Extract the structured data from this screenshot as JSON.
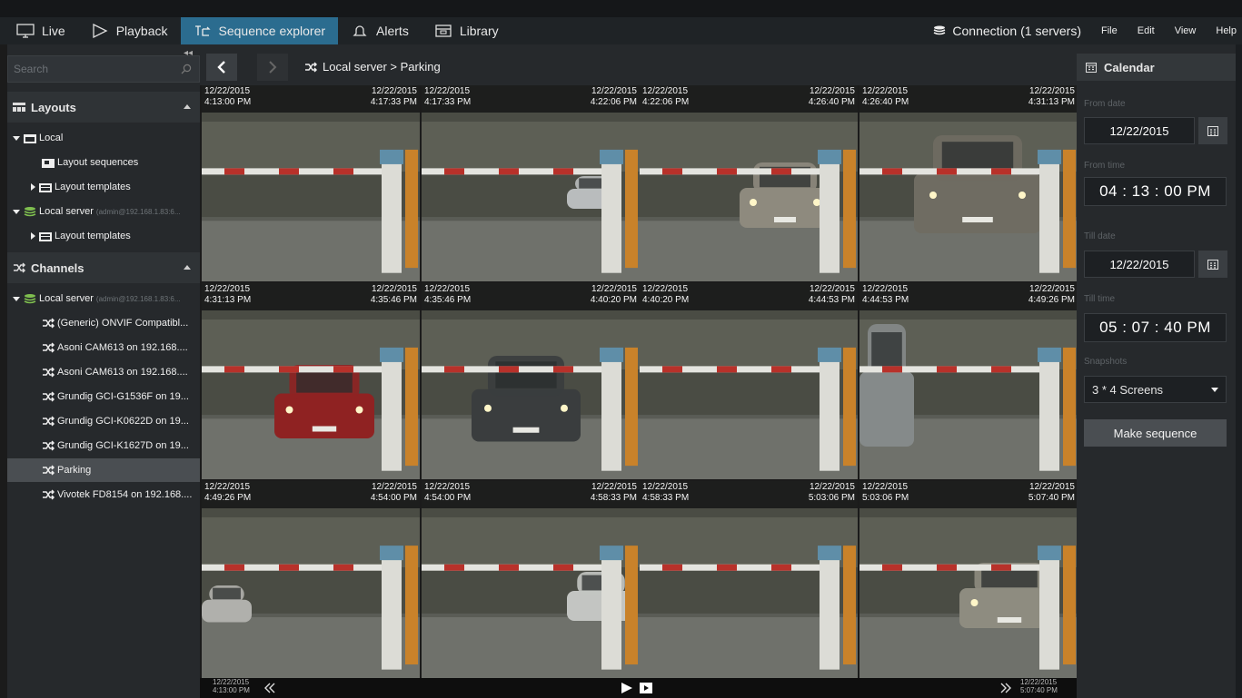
{
  "tabs": [
    {
      "label": "Live",
      "icon": "monitor-icon"
    },
    {
      "label": "Playback",
      "icon": "play-outline-icon"
    },
    {
      "label": "Sequence explorer",
      "icon": "sequence-icon",
      "active": true
    },
    {
      "label": "Alerts",
      "icon": "bell-icon"
    },
    {
      "label": "Library",
      "icon": "library-icon"
    }
  ],
  "menu": {
    "connection": "Connection (1 servers)",
    "file": "File",
    "edit": "Edit",
    "view": "View",
    "help": "Help"
  },
  "sidebar": {
    "search_placeholder": "Search",
    "layouts_title": "Layouts",
    "layouts": [
      "Local",
      "Layout sequences",
      "Layout templates",
      "Local server",
      "Layout templates"
    ],
    "layouts_server_note": "(admin@192.168.1.83:6...",
    "channels_title": "Channels",
    "channel_server": "Local server",
    "channel_server_note": "(admin@192.168.1.83:6...",
    "channels": [
      "(Generic) ONVIF Compatibl...",
      "Asoni CAM613 on 192.168....",
      "Asoni CAM613 on 192.168....",
      "Grundig GCI-G1536F on 19...",
      "Grundig GCI-K0622D on 19...",
      "Grundig GCI-K1627D on 19...",
      "Parking",
      "Vivotek FD8154 on 192.168...."
    ]
  },
  "breadcrumb": "Local server > Parking",
  "cells": [
    {
      "date_l": "12/22/2015",
      "time_l": "4:13:00 PM",
      "date_r": "12/22/2015",
      "time_r": "4:17:33 PM"
    },
    {
      "date_l": "12/22/2015",
      "time_l": "4:17:33 PM",
      "date_r": "12/22/2015",
      "time_r": "4:22:06 PM"
    },
    {
      "date_l": "12/22/2015",
      "time_l": "4:22:06 PM",
      "date_r": "12/22/2015",
      "time_r": "4:26:40 PM"
    },
    {
      "date_l": "12/22/2015",
      "time_l": "4:26:40 PM",
      "date_r": "12/22/2015",
      "time_r": "4:31:13 PM"
    },
    {
      "date_l": "12/22/2015",
      "time_l": "4:31:13 PM",
      "date_r": "12/22/2015",
      "time_r": "4:35:46 PM"
    },
    {
      "date_l": "12/22/2015",
      "time_l": "4:35:46 PM",
      "date_r": "12/22/2015",
      "time_r": "4:40:20 PM"
    },
    {
      "date_l": "12/22/2015",
      "time_l": "4:40:20 PM",
      "date_r": "12/22/2015",
      "time_r": "4:44:53 PM"
    },
    {
      "date_l": "12/22/2015",
      "time_l": "4:44:53 PM",
      "date_r": "12/22/2015",
      "time_r": "4:49:26 PM"
    },
    {
      "date_l": "12/22/2015",
      "time_l": "4:49:26 PM",
      "date_r": "12/22/2015",
      "time_r": "4:54:00 PM"
    },
    {
      "date_l": "12/22/2015",
      "time_l": "4:54:00 PM",
      "date_r": "12/22/2015",
      "time_r": "4:58:33 PM"
    },
    {
      "date_l": "12/22/2015",
      "time_l": "4:58:33 PM",
      "date_r": "12/22/2015",
      "time_r": "5:03:06 PM"
    },
    {
      "date_l": "12/22/2015",
      "time_l": "5:03:06 PM",
      "date_r": "12/22/2015",
      "time_r": "5:07:40 PM"
    }
  ],
  "player": {
    "start_date": "12/22/2015",
    "start_time": "4:13:00 PM",
    "end_date": "12/22/2015",
    "end_time": "5:07:40 PM"
  },
  "calendar": {
    "title": "Calendar",
    "from_date_label": "From date",
    "from_date": "12/22/2015",
    "from_time_label": "From time",
    "from_time": "04 : 13 : 00  PM",
    "till_date_label": "Till date",
    "till_date": "12/22/2015",
    "till_time_label": "Till time",
    "till_time": "05 : 07 : 40  PM",
    "snapshots_label": "Snapshots",
    "snapshots": "3 * 4 Screens",
    "make_sequence": "Make sequence"
  },
  "colors": {
    "accent": "#2b6c8f",
    "panel": "#26292c",
    "barrier_red": "#b8312a",
    "post_orange": "#c9822a"
  }
}
